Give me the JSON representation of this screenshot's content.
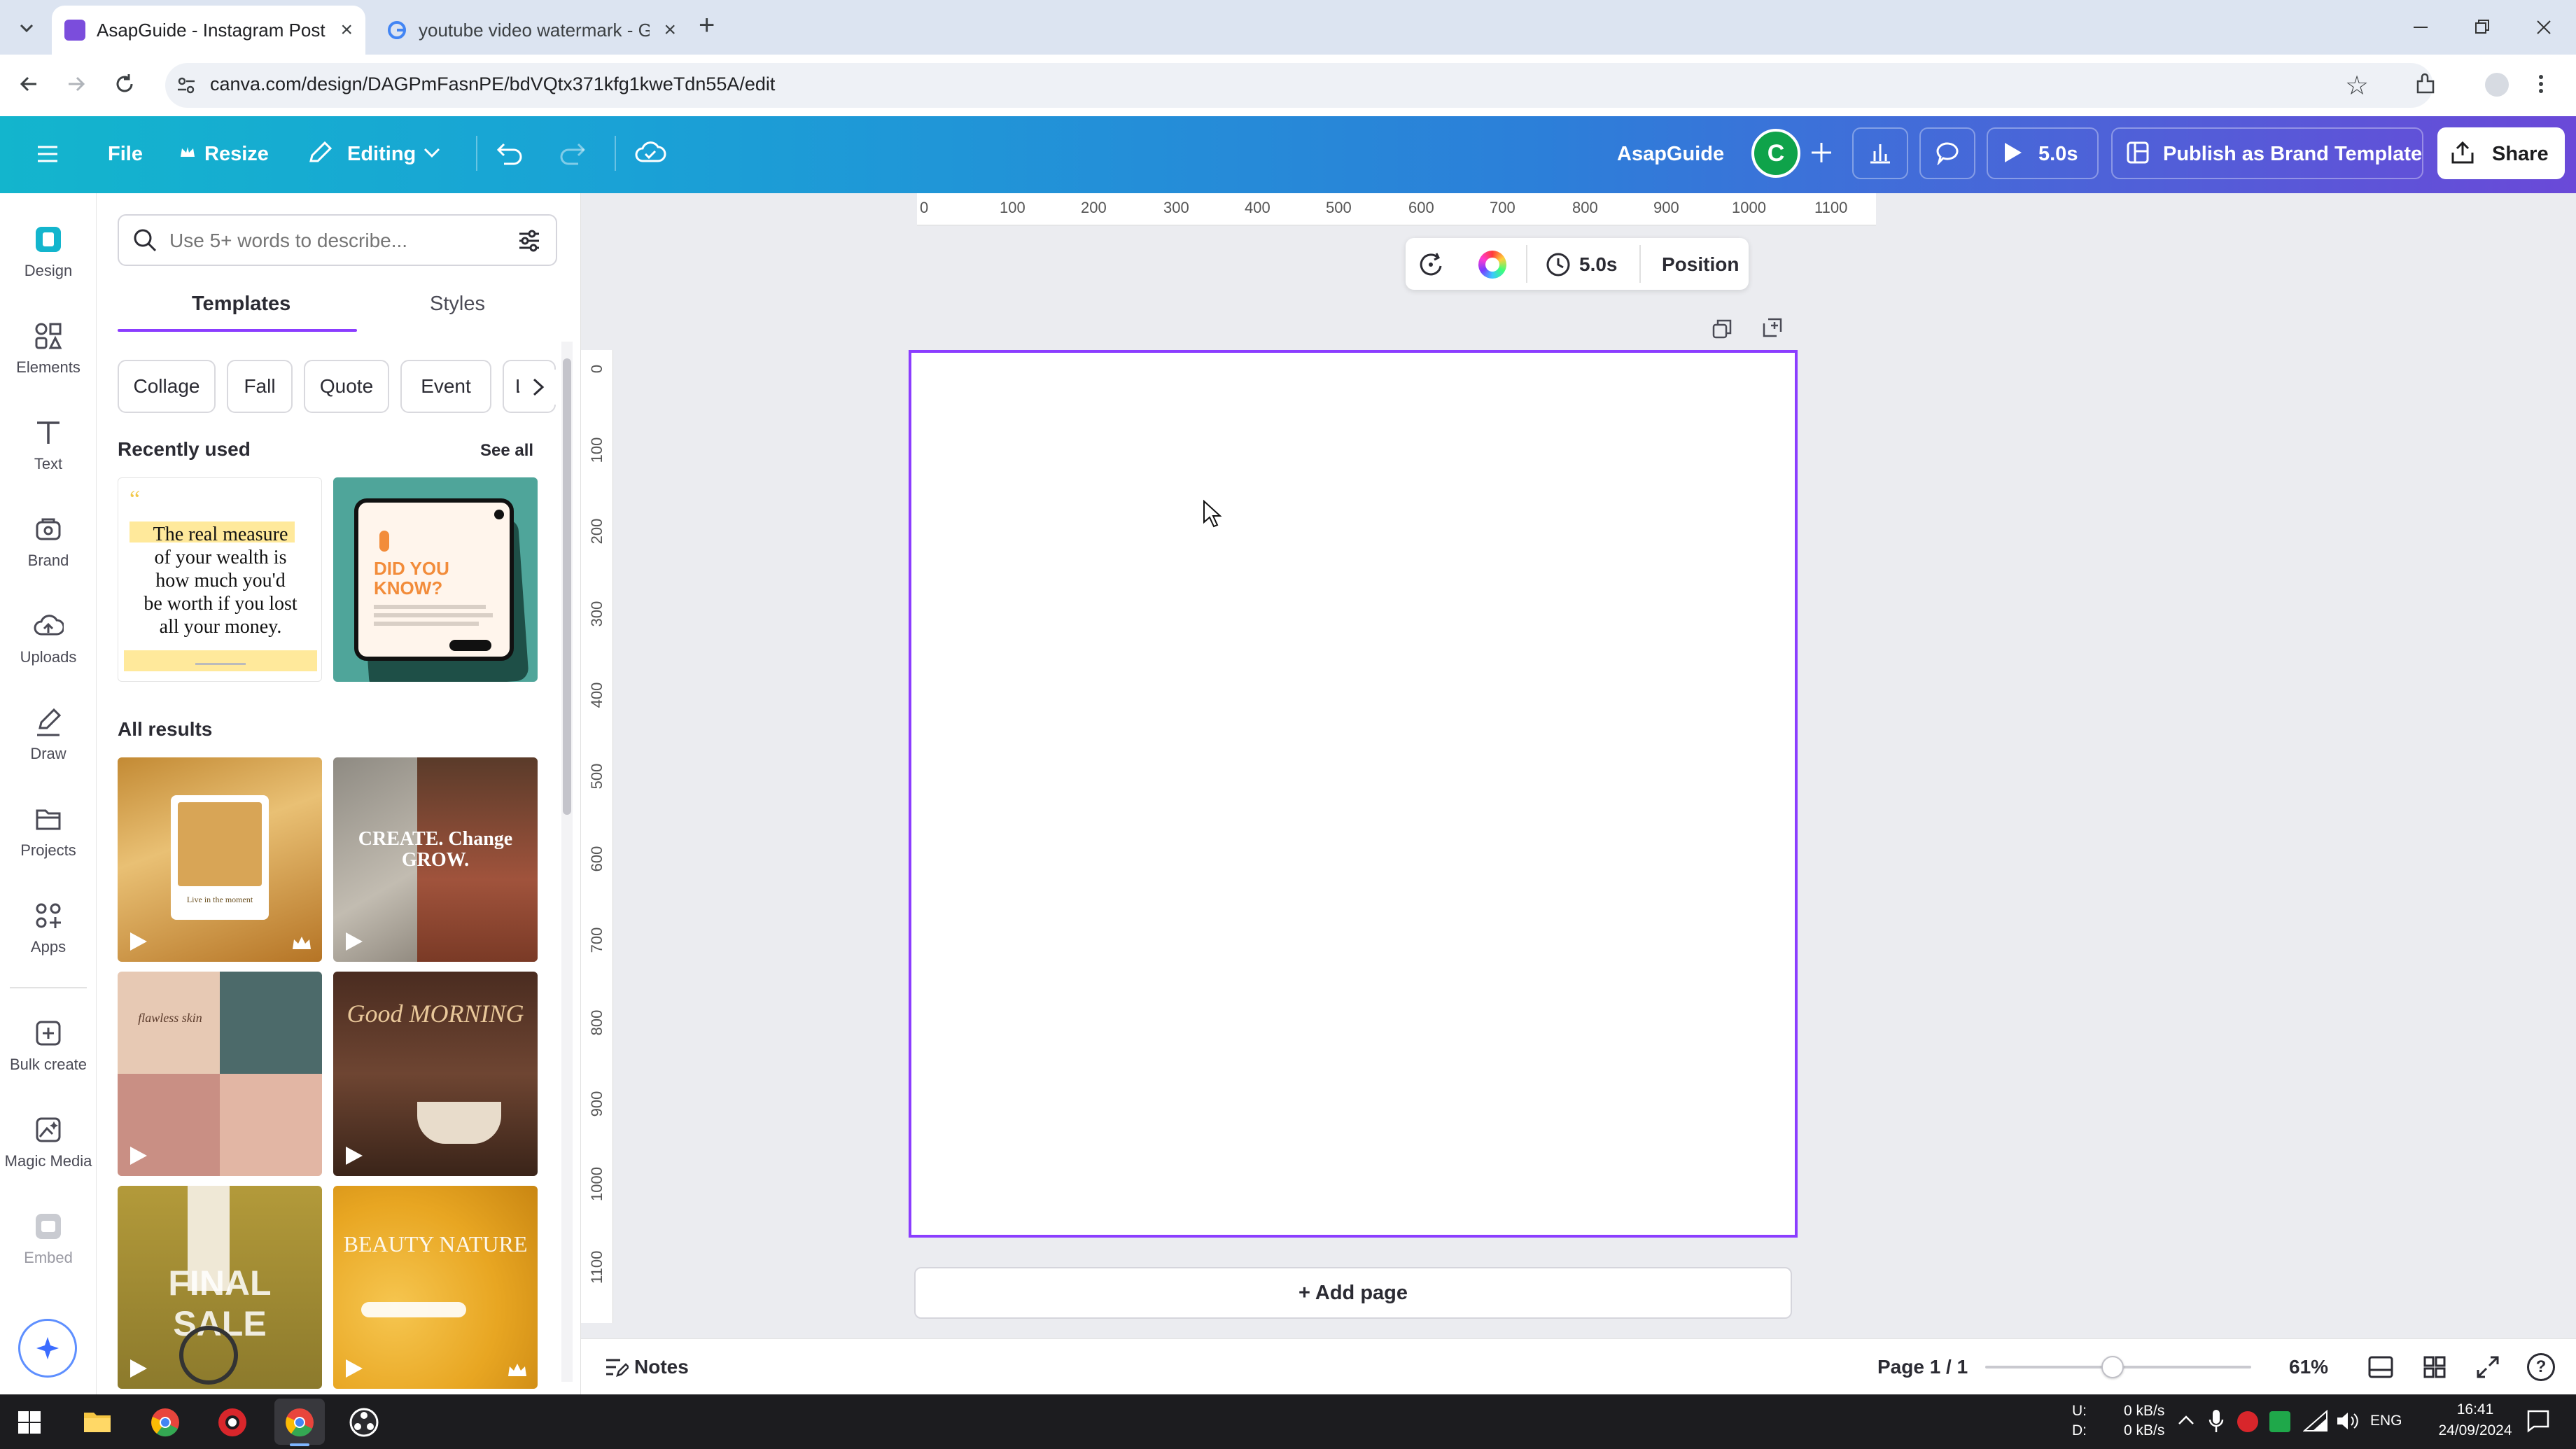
{
  "browser": {
    "tabs": [
      {
        "title": "AsapGuide - Instagram Post - C",
        "icon": "canva-icon",
        "active": true
      },
      {
        "title": "youtube video watermark - Goo",
        "icon": "google-icon",
        "active": false
      }
    ],
    "url": "canva.com/design/DAGPmFasnPE/bdVQtx371kfg1kweTdn55A/edit"
  },
  "header": {
    "menu": [
      "File",
      "Resize",
      "Editing"
    ],
    "team_name": "AsapGuide",
    "avatar_letter": "C",
    "play_duration": "5.0s",
    "publish_label": "Publish as Brand Template",
    "share_label": "Share"
  },
  "rail": [
    {
      "label": "Design",
      "icon": "design-icon"
    },
    {
      "label": "Elements",
      "icon": "elements-icon"
    },
    {
      "label": "Text",
      "icon": "text-icon"
    },
    {
      "label": "Brand",
      "icon": "brand-icon"
    },
    {
      "label": "Uploads",
      "icon": "uploads-icon"
    },
    {
      "label": "Draw",
      "icon": "draw-icon"
    },
    {
      "label": "Projects",
      "icon": "projects-icon"
    },
    {
      "label": "Apps",
      "icon": "apps-icon"
    },
    {
      "label": "Bulk create",
      "icon": "bulk-create-icon"
    },
    {
      "label": "Magic Media",
      "icon": "magic-media-icon"
    },
    {
      "label": "Embed",
      "icon": "embed-icon"
    }
  ],
  "panel": {
    "search_placeholder": "Use 5+ words to describe...",
    "tabs": [
      "Templates",
      "Styles"
    ],
    "chips": [
      "Collage",
      "Fall",
      "Quote",
      "Event",
      "L"
    ],
    "recently_used_heading": "Recently used",
    "see_all": "See all",
    "all_results_heading": "All results",
    "recent_templates": [
      {
        "lines": [
          "The real measure",
          "of your wealth is",
          "how much you'd",
          "be worth if you lost",
          "all your money."
        ]
      },
      {
        "title": "DID YOU KNOW?"
      }
    ],
    "results": [
      {
        "caption": "Live in the moment"
      },
      {
        "caption": "CREATE. Change GROW."
      },
      {
        "caption": "flawless skin"
      },
      {
        "caption": "Good MORNING"
      },
      {
        "caption": "FINAL SALE"
      },
      {
        "caption": "BEAUTY NATURE"
      }
    ]
  },
  "editor": {
    "ruler_h": [
      "0",
      "100",
      "200",
      "300",
      "400",
      "500",
      "600",
      "700",
      "800",
      "900",
      "1000",
      "1100"
    ],
    "ruler_v": [
      "0",
      "100",
      "200",
      "300",
      "400",
      "500",
      "600",
      "700",
      "800",
      "900",
      "1000",
      "1100"
    ],
    "toolbar_duration": "5.0s",
    "toolbar_position": "Position",
    "add_page": "+ Add page",
    "notes": "Notes",
    "page_indicator": "Page 1 / 1",
    "zoom": "61%",
    "zoom_level": 0.48
  },
  "taskbar": {
    "net_up_label": "U:",
    "net_down_label": "D:",
    "net_up": "0 kB/s",
    "net_down": "0 kB/s",
    "lang": "ENG",
    "time": "16:41",
    "date": "24/09/2024"
  },
  "colors": {
    "accent": "#8b3dff",
    "header_start": "#13b5cd",
    "header_end": "#6a49d8"
  }
}
